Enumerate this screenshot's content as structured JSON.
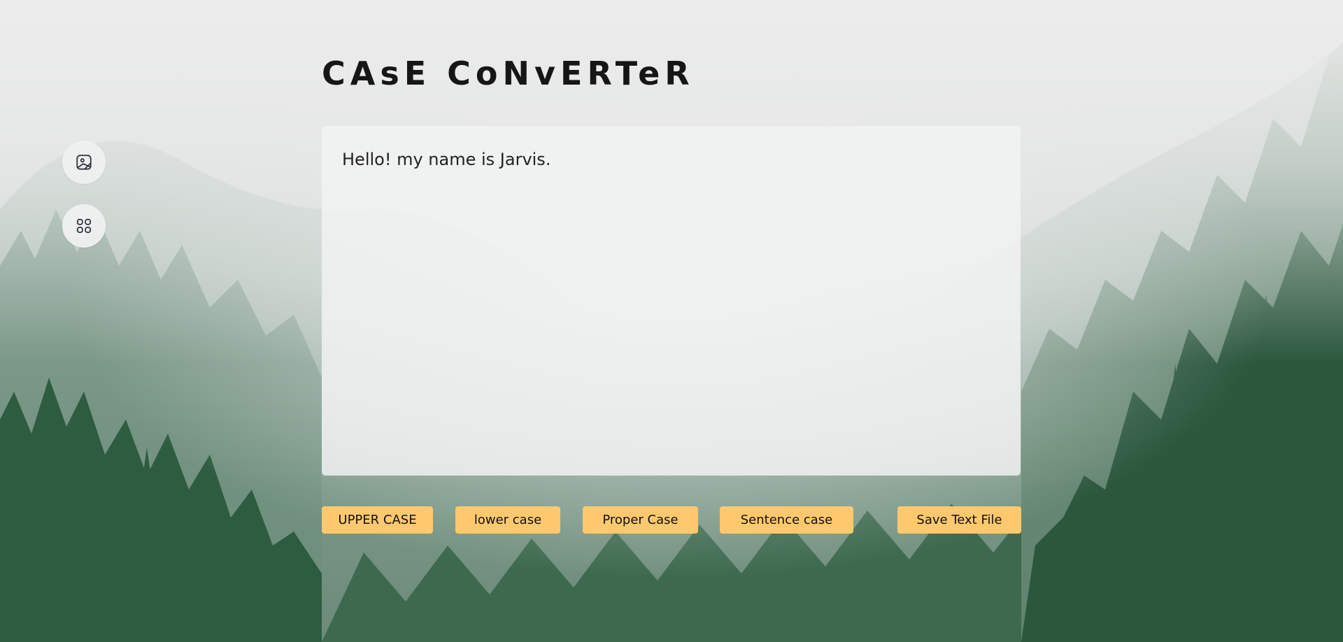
{
  "app": {
    "title": "CAsE CoNvERTeR"
  },
  "sidebar": {
    "buttons": [
      {
        "icon": "image-icon"
      },
      {
        "icon": "grid-icon"
      }
    ]
  },
  "editor": {
    "value": "Hello! my name is Jarvis.",
    "placeholder": ""
  },
  "actions": {
    "upper_label": "UPPER CASE",
    "lower_label": "lower case",
    "proper_label": "Proper Case",
    "sentence_label": "Sentence case",
    "save_label": "Save Text File"
  },
  "colors": {
    "button_accent": "#fec96e",
    "title_text": "#161616",
    "forest_dark": "#2f5a41",
    "fog": "#e6e7e6"
  }
}
